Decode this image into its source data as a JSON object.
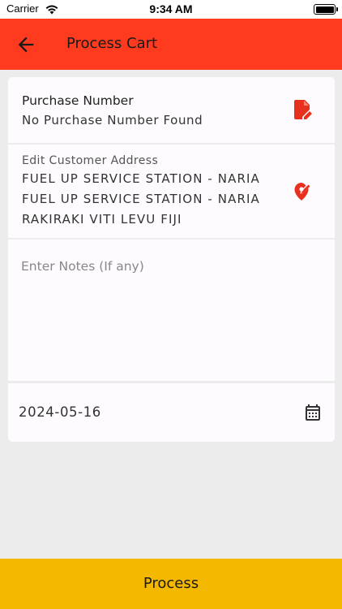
{
  "status_bar": {
    "carrier": "Carrier",
    "time": "9:34 AM",
    "wifi_icon": "wifi-icon",
    "battery_icon": "battery-icon"
  },
  "app_bar": {
    "title": "Process Cart",
    "back_icon": "arrow-left-icon",
    "color": "#ff3b1f"
  },
  "purchase": {
    "label": "Purchase Number",
    "value": "No Purchase Number Found",
    "icon": "edit-document-icon",
    "icon_color": "#e8301f"
  },
  "address": {
    "label": "Edit Customer Address",
    "lines": [
      "FUEL UP SERVICE STATION - NARIA",
      "FUEL UP SERVICE STATION - NARIA",
      "RAKIRAKI VITI LEVU FIJI"
    ],
    "icon": "edit-location-icon"
  },
  "notes": {
    "placeholder": "Enter Notes (If any)",
    "value": ""
  },
  "date": {
    "value": "2024-05-16",
    "icon": "calendar-icon"
  },
  "process_button": {
    "label": "Process",
    "color": "#f5b800"
  }
}
